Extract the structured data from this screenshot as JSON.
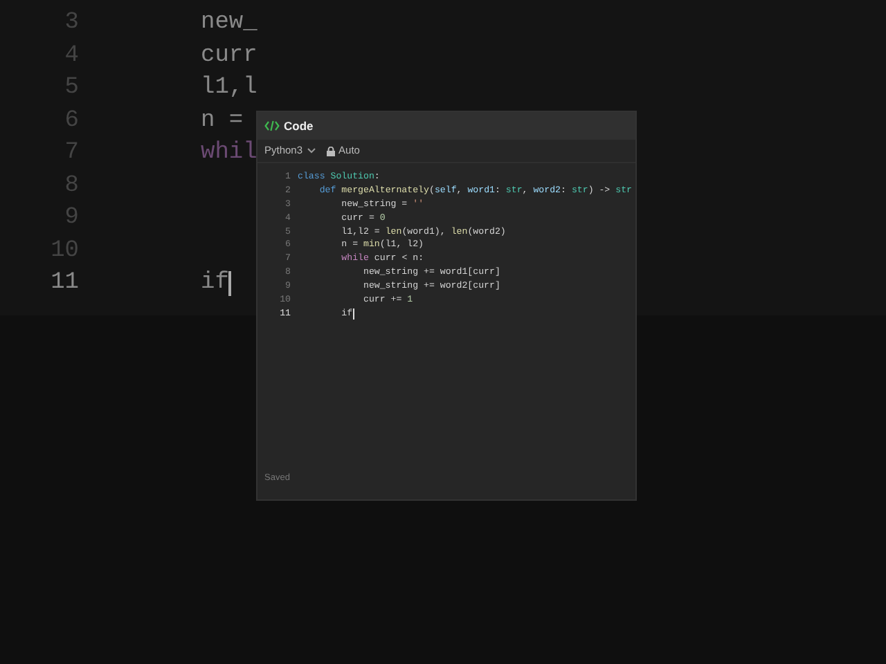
{
  "background_editor": {
    "lines": [
      {
        "number": "3",
        "text": "new_",
        "kind": "plain",
        "active": false
      },
      {
        "number": "4",
        "text": "curr",
        "kind": "plain",
        "active": false
      },
      {
        "number": "5",
        "text": "l1,l",
        "kind": "plain",
        "active": false
      },
      {
        "number": "6",
        "text": "n = ",
        "kind": "plain",
        "active": false
      },
      {
        "number": "7",
        "text": "whil",
        "kind": "control",
        "active": false
      },
      {
        "number": "8",
        "active": false
      },
      {
        "number": "9",
        "active": false
      },
      {
        "number": "10",
        "active": false
      },
      {
        "number": "11",
        "text": "if",
        "kind": "plain",
        "active": true
      }
    ]
  },
  "panel": {
    "title": "Code",
    "language": "Python3",
    "mode": "Auto",
    "status": "Saved",
    "lines": [
      {
        "number": "1",
        "active": false,
        "tokens": [
          {
            "text": "class",
            "kind": "keyword"
          },
          {
            "text": " Solution",
            "kind": "type"
          },
          {
            "text": ":",
            "kind": "plain"
          }
        ]
      },
      {
        "number": "2",
        "active": false,
        "tokens": [
          {
            "text": "    def",
            "kind": "keyword"
          },
          {
            "text": " mergeAlternately",
            "kind": "function"
          },
          {
            "text": "(",
            "kind": "plain"
          },
          {
            "text": "self",
            "kind": "param"
          },
          {
            "text": ", ",
            "kind": "plain"
          },
          {
            "text": "word1",
            "kind": "param"
          },
          {
            "text": ": ",
            "kind": "plain"
          },
          {
            "text": "str",
            "kind": "type"
          },
          {
            "text": ", ",
            "kind": "plain"
          },
          {
            "text": "word2",
            "kind": "param"
          },
          {
            "text": ": ",
            "kind": "plain"
          },
          {
            "text": "str",
            "kind": "type"
          },
          {
            "text": ") -> ",
            "kind": "plain"
          },
          {
            "text": "str",
            "kind": "type"
          }
        ]
      },
      {
        "number": "3",
        "active": false,
        "tokens": [
          {
            "text": "        new_string = ",
            "kind": "plain"
          },
          {
            "text": "''",
            "kind": "string"
          }
        ]
      },
      {
        "number": "4",
        "active": false,
        "tokens": [
          {
            "text": "        curr = ",
            "kind": "plain"
          },
          {
            "text": "0",
            "kind": "number"
          }
        ]
      },
      {
        "number": "5",
        "active": false,
        "tokens": [
          {
            "text": "        l1,l2 = ",
            "kind": "plain"
          },
          {
            "text": "len",
            "kind": "function"
          },
          {
            "text": "(word1), ",
            "kind": "plain"
          },
          {
            "text": "len",
            "kind": "function"
          },
          {
            "text": "(word2)",
            "kind": "plain"
          }
        ]
      },
      {
        "number": "6",
        "active": false,
        "tokens": [
          {
            "text": "        n = ",
            "kind": "plain"
          },
          {
            "text": "min",
            "kind": "function"
          },
          {
            "text": "(l1, l2)",
            "kind": "plain"
          }
        ]
      },
      {
        "number": "7",
        "active": false,
        "tokens": [
          {
            "text": "        while",
            "kind": "control"
          },
          {
            "text": " curr < n:",
            "kind": "plain"
          }
        ]
      },
      {
        "number": "8",
        "active": false,
        "tokens": [
          {
            "text": "            new_string += word1[curr]",
            "kind": "plain"
          }
        ]
      },
      {
        "number": "9",
        "active": false,
        "tokens": [
          {
            "text": "            new_string += word2[curr]",
            "kind": "plain"
          }
        ]
      },
      {
        "number": "10",
        "active": false,
        "tokens": [
          {
            "text": "            curr += ",
            "kind": "plain"
          },
          {
            "text": "1",
            "kind": "number"
          }
        ]
      },
      {
        "number": "11",
        "active": true,
        "tokens": [
          {
            "text": "        if",
            "kind": "plain"
          }
        ]
      }
    ]
  }
}
